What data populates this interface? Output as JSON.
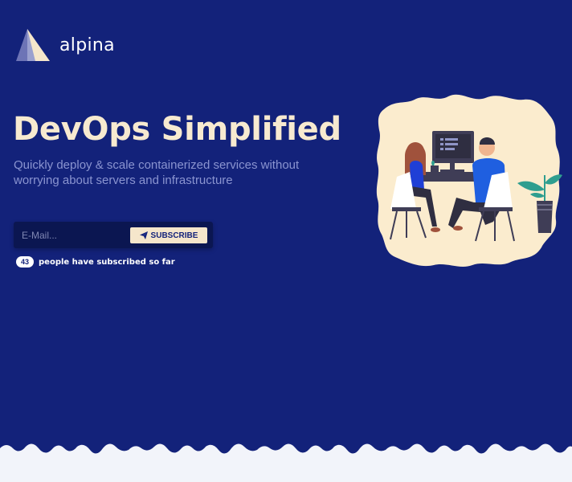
{
  "brand": {
    "name": "alpina"
  },
  "hero": {
    "title": "DevOps Simplified",
    "subtitle": "Quickly deploy & scale containerized services without worrying about servers and infrastructure"
  },
  "subscribe": {
    "placeholder": "E-Mail...",
    "button_label": "SUBSCRIBE",
    "button_icon": "paper-plane-icon",
    "subscriber_count": "43",
    "subscriber_text": "people have subscribed so far"
  },
  "colors": {
    "background": "#13227a",
    "accent": "#f5e6cb",
    "input_bg": "#0b1651",
    "illustration_bg": "#fbecce",
    "footer": "#f2f4fa"
  }
}
